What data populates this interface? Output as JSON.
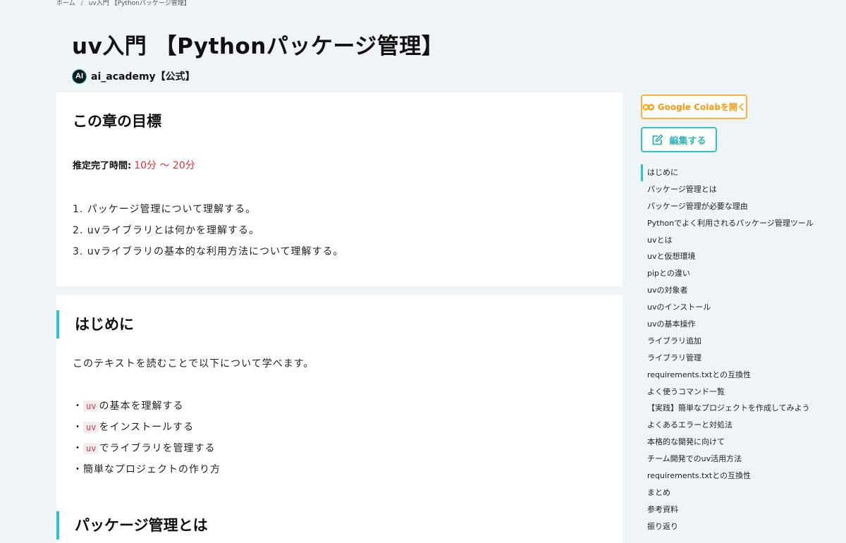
{
  "breadcrumb": {
    "home": "ホーム",
    "separator": "/",
    "current": "uv入門 【Pythonパッケージ管理】"
  },
  "page": {
    "title": "uv入門 【Pythonパッケージ管理】"
  },
  "author": {
    "initials": "AI",
    "name": "ai_academy【公式】"
  },
  "goals": {
    "heading": "この章の目標",
    "estimate_label": "推定完了時間:",
    "estimate_value": "10分 〜 20分",
    "items": [
      "1. パッケージ管理について理解する。",
      "2. uvライブラリとは何かを理解する。",
      "3. uvライブラリの基本的な利用方法について理解する。"
    ]
  },
  "intro": {
    "heading": "はじめに",
    "text": "このテキストを読むことで以下について学べます。",
    "bullets": [
      {
        "prefix": "・",
        "code": "uv",
        "text": "の基本を理解する"
      },
      {
        "prefix": "・",
        "code": "uv",
        "text": "をインストールする"
      },
      {
        "prefix": "・",
        "code": "uv",
        "text": "でライブラリを管理する"
      },
      {
        "prefix": "・",
        "text": "簡単なプロジェクトの作り方"
      }
    ]
  },
  "next_section": {
    "heading": "パッケージ管理とは"
  },
  "sidebar": {
    "colab_label": "Google Colabを開く",
    "edit_label": "編集する",
    "colors": {
      "colab": "#f7b33b",
      "accent": "#2fc3c9"
    },
    "toc": [
      "はじめに",
      "パッケージ管理とは",
      "パッケージ管理が必要な理由",
      "Pythonでよく利用されるパッケージ管理ツール",
      "uvとは",
      "uvと仮想環境",
      "pipとの違い",
      "uvの対象者",
      "uvのインストール",
      "uvの基本操作",
      "ライブラリ追加",
      "ライブラリ管理",
      "requirements.txtとの互換性",
      "よく使うコマンド一覧",
      "【実践】簡単なプロジェクトを作成してみよう",
      "よくあるエラーと対処法",
      "本格的な開発に向けて",
      "チーム開発でのuv活用方法",
      "requirements.txtとの互換性",
      "まとめ",
      "参考資料",
      "振り返り"
    ]
  }
}
